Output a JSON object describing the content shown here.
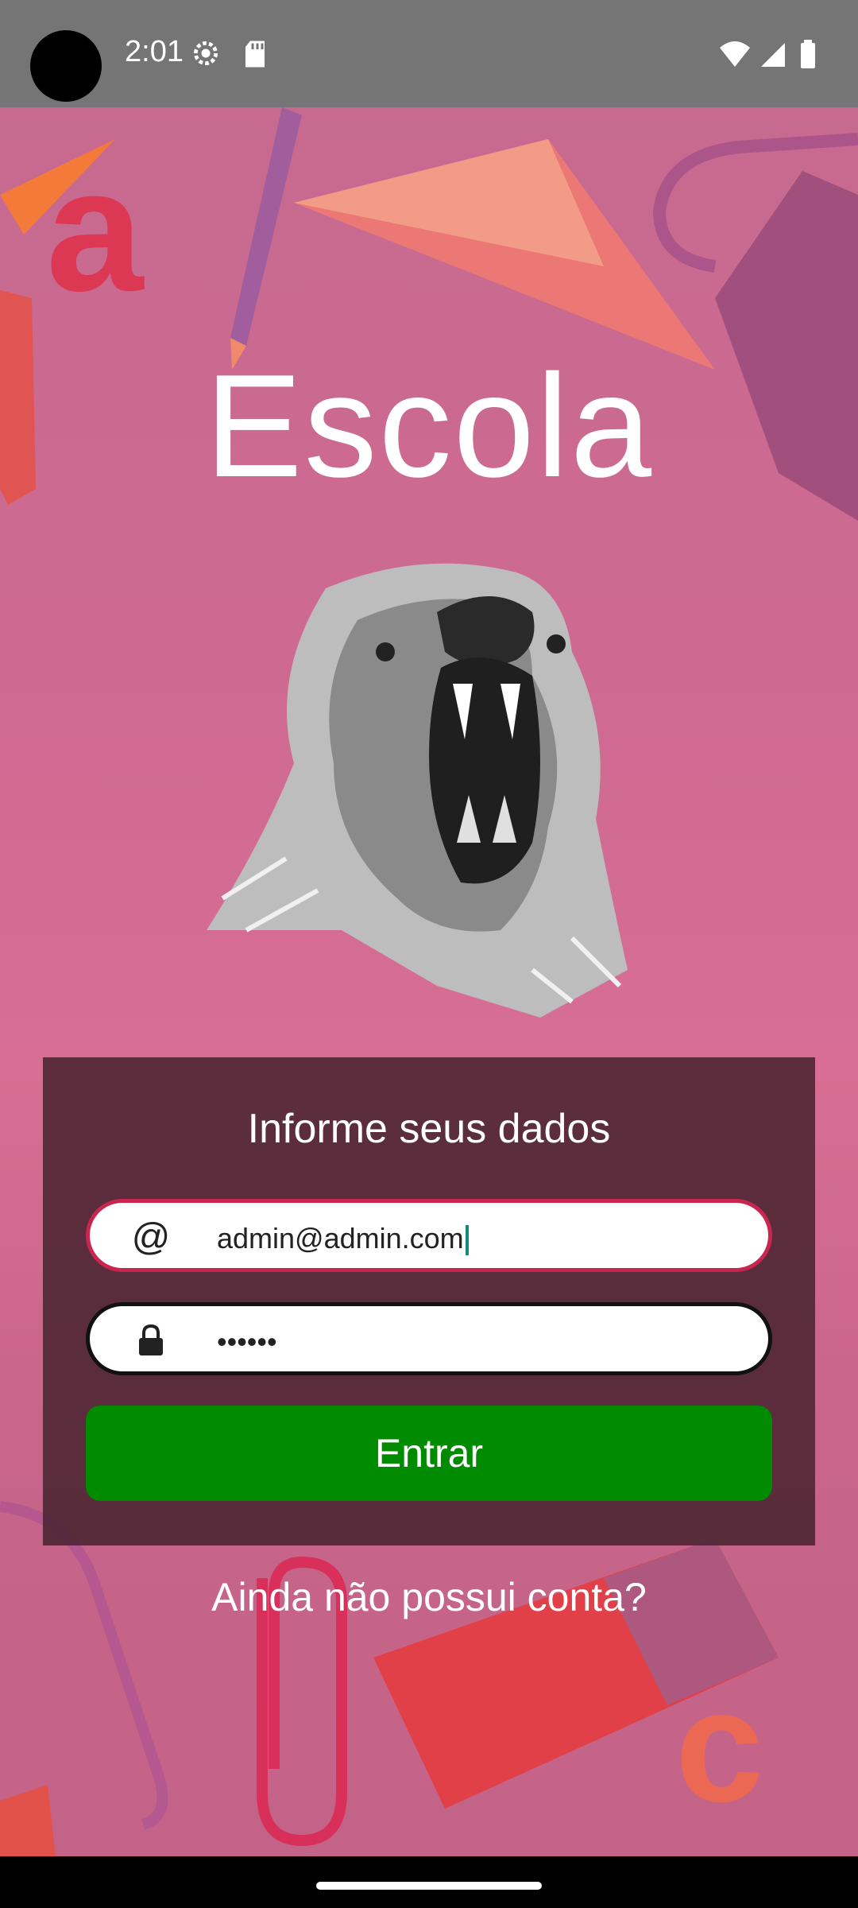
{
  "status_bar": {
    "time": "2:01",
    "icons": [
      "gear-icon",
      "sd-card-icon",
      "wifi-icon",
      "signal-icon",
      "battery-icon"
    ]
  },
  "app": {
    "title": "Escola",
    "logo": "bear-logo"
  },
  "login_card": {
    "title": "Informe seus dados",
    "email_icon": "@",
    "email_value": "admin@admin.com",
    "password_value": "••••••",
    "submit_label": "Entrar"
  },
  "signup_link": "Ainda não possui conta?",
  "colors": {
    "background": "#c9638a",
    "card": "#4a2431",
    "button": "#008b00",
    "email_border": "#c8264e"
  }
}
